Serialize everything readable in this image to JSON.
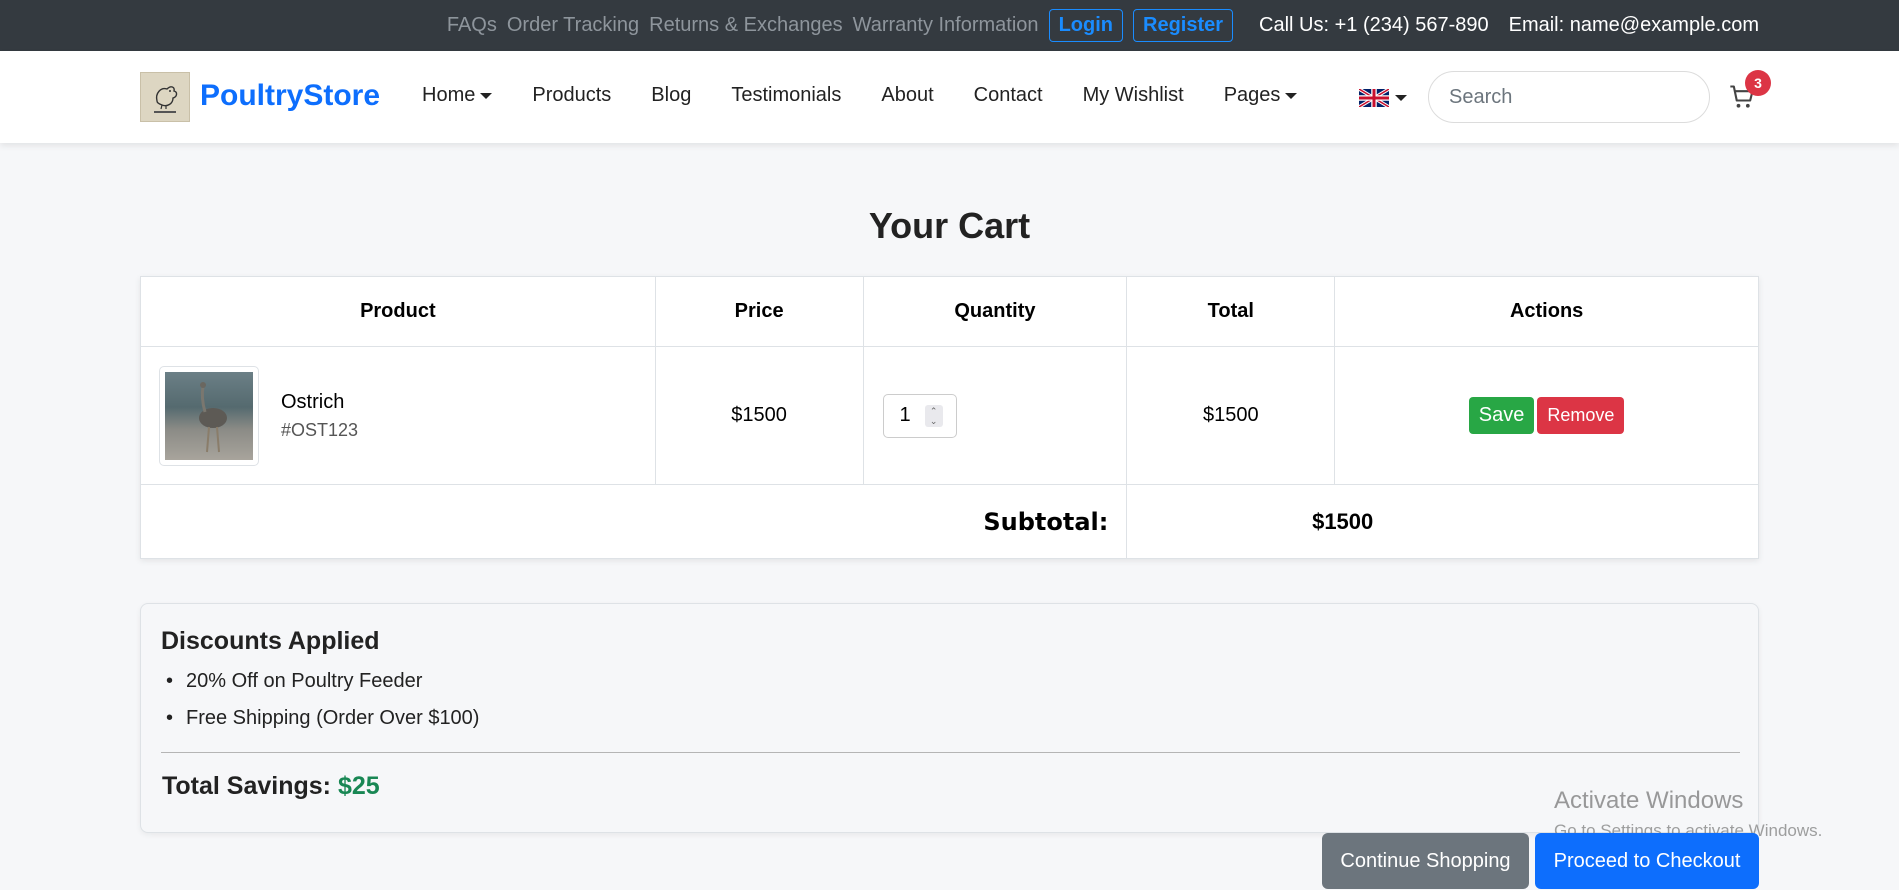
{
  "topbar": {
    "links": [
      "FAQs",
      "Order Tracking",
      "Returns & Exchanges",
      "Warranty Information"
    ],
    "login": "Login",
    "register": "Register",
    "phone": "Call Us: +1 (234) 567-890",
    "email": "Email: name@example.com"
  },
  "navbar": {
    "brand": "PoultryStore",
    "items": [
      {
        "label": "Home",
        "dropdown": true
      },
      {
        "label": "Products",
        "dropdown": false
      },
      {
        "label": "Blog",
        "dropdown": false
      },
      {
        "label": "Testimonials",
        "dropdown": false
      },
      {
        "label": "About",
        "dropdown": false
      },
      {
        "label": "Contact",
        "dropdown": false
      },
      {
        "label": "My Wishlist",
        "dropdown": false
      },
      {
        "label": "Pages",
        "dropdown": true
      }
    ],
    "search_placeholder": "Search",
    "cart_count": "3"
  },
  "page": {
    "title": "Your Cart"
  },
  "cart": {
    "headers": [
      "Product",
      "Price",
      "Quantity",
      "Total",
      "Actions"
    ],
    "items": [
      {
        "name": "Ostrich",
        "sku": "#OST123",
        "price": "$1500",
        "quantity": "1",
        "total": "$1500"
      }
    ],
    "save_label": "Save",
    "remove_label": "Remove",
    "subtotal_label": "Subtotal:",
    "subtotal_value": "$1500"
  },
  "discounts": {
    "title": "Discounts Applied",
    "items": [
      "20% Off on Poultry Feeder",
      "Free Shipping (Order Over $100)"
    ],
    "savings_label": "Total Savings:",
    "savings_value": "$25"
  },
  "actions": {
    "continue": "Continue Shopping",
    "checkout": "Proceed to Checkout"
  },
  "watermark": {
    "title": "Activate Windows",
    "subtitle": "Go to Settings to activate Windows."
  },
  "colors": {
    "topbar_bg": "#343a40",
    "brand": "#0d6efd",
    "save": "#28a745",
    "remove": "#dc3545",
    "savings": "#198754",
    "continue": "#6c757d",
    "checkout": "#0d6efd"
  }
}
